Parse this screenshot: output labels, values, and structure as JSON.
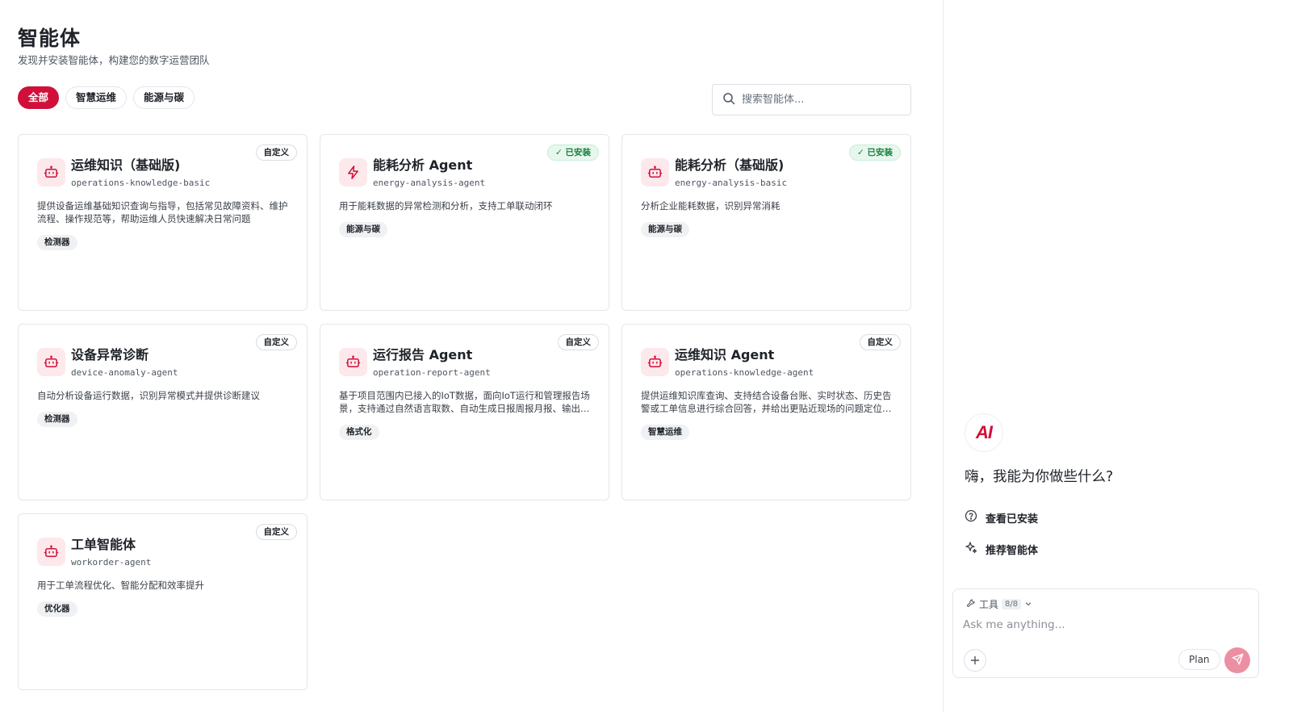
{
  "header": {
    "title": "智能体",
    "subtitle": "发现并安装智能体，构建您的数字运营团队"
  },
  "filters": [
    {
      "label": "全部",
      "active": true
    },
    {
      "label": "智慧运维",
      "active": false
    },
    {
      "label": "能源与碳",
      "active": false
    }
  ],
  "search": {
    "placeholder": "搜索智能体..."
  },
  "agents": [
    {
      "name": "运维知识（基础版)",
      "slug": "operations-knowledge-basic",
      "badge": "自定义",
      "installed": false,
      "icon": "robot-icon",
      "desc": "提供设备运维基础知识查询与指导，包括常见故障资料、维护流程、操作规范等，帮助运维人员快速解决日常问题",
      "tag": "检测器"
    },
    {
      "name": "能耗分析 Agent",
      "slug": "energy-analysis-agent",
      "badge": "已安装",
      "installed": true,
      "icon": "lightning-icon",
      "desc": "用于能耗数据的异常检测和分析，支持工单联动闭环",
      "tag": "能源与碳"
    },
    {
      "name": "能耗分析（基础版)",
      "slug": "energy-analysis-basic",
      "badge": "已安装",
      "installed": true,
      "icon": "robot-icon",
      "desc": "分析企业能耗数据，识别异常消耗",
      "tag": "能源与碳"
    },
    {
      "name": "设备异常诊断",
      "slug": "device-anomaly-agent",
      "badge": "自定义",
      "installed": false,
      "icon": "robot-icon",
      "desc": "自动分析设备运行数据，识别异常模式并提供诊断建议",
      "tag": "检测器"
    },
    {
      "name": "运行报告 Agent",
      "slug": "operation-report-agent",
      "badge": "自定义",
      "installed": false,
      "icon": "robot-icon",
      "desc": "基于项目范围内已接入的IoT数据，面向IoT运行和管理报告场景，支持通过自然语言取数、自动生成日报周报月报、输出分析结论",
      "tag": "格式化"
    },
    {
      "name": "运维知识 Agent",
      "slug": "operations-knowledge-agent",
      "badge": "自定义",
      "installed": false,
      "icon": "robot-icon",
      "desc": "提供运维知识库查询、支持结合设备台账、实时状态、历史告警或工单信息进行综合回答，并给出更贴近现场的问题定位建议",
      "tag": "智慧运维"
    },
    {
      "name": "工单智能体",
      "slug": "workorder-agent",
      "badge": "自定义",
      "installed": false,
      "icon": "robot-icon",
      "desc": "用于工单流程优化、智能分配和效率提升",
      "tag": "优化器"
    }
  ],
  "assistant": {
    "logo_text": "AI",
    "greeting": "嗨，我能为你做些什么?",
    "quick_actions": [
      {
        "label": "查看已安装",
        "icon": "question-circle-icon"
      },
      {
        "label": "推荐智能体",
        "icon": "sparkle-icon"
      }
    ],
    "tools_label": "工具",
    "tools_count": "8/8",
    "input_placeholder": "Ask me anything...",
    "plan_label": "Plan"
  },
  "colors": {
    "accent": "#d0103a",
    "installed_bg": "#e8f7ee",
    "installed_text": "#17803d",
    "icon_bg": "#fde8ec"
  }
}
